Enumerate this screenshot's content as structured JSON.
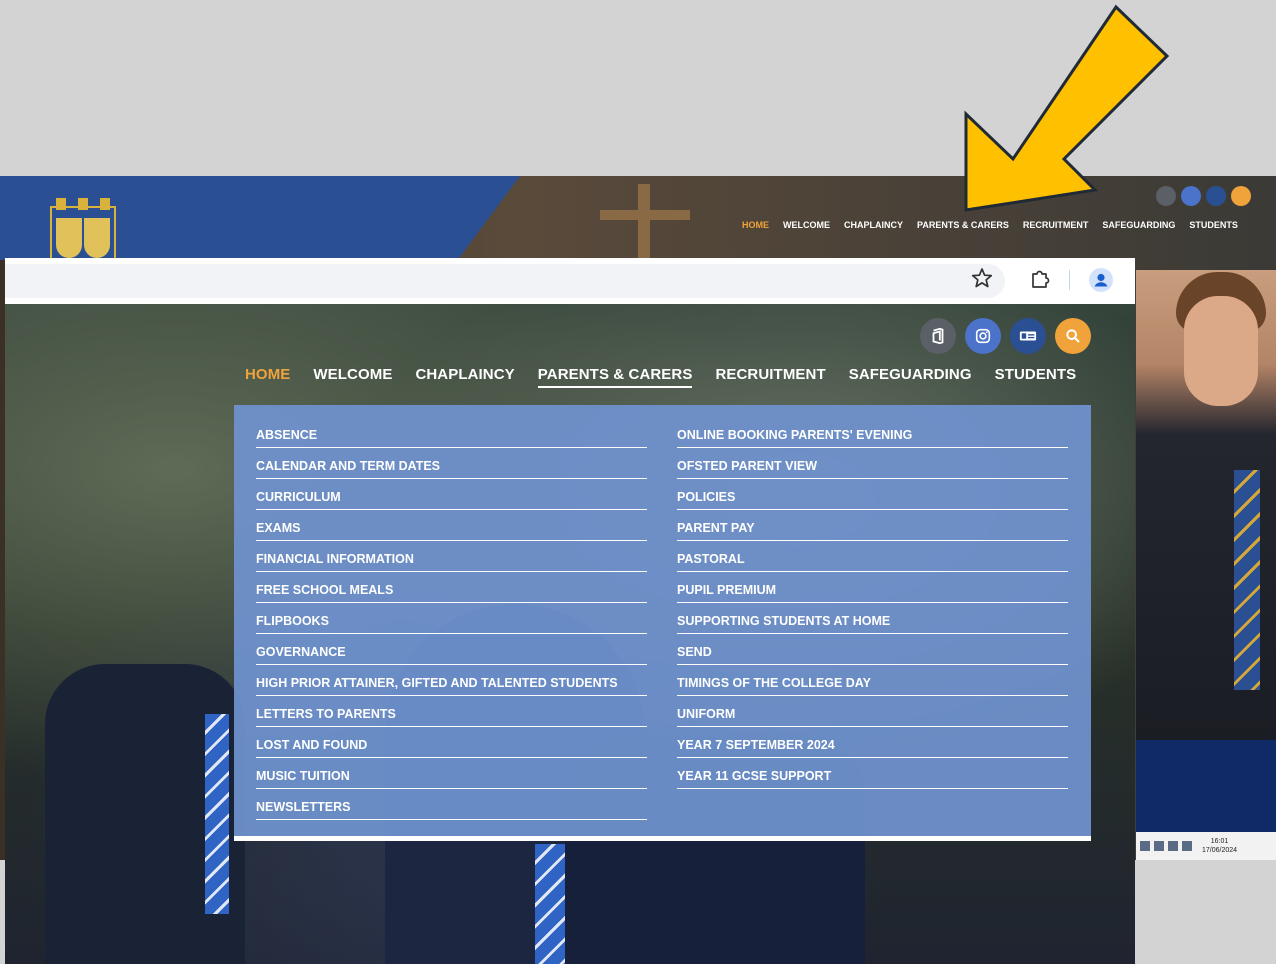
{
  "background_site": {
    "nav": [
      "HOME",
      "WELCOME",
      "CHAPLAINCY",
      "PARENTS & CARERS",
      "RECRUITMENT",
      "SAFEGUARDING",
      "STUDENTS"
    ],
    "clock_time": "16:01",
    "clock_date": "17/06/2024"
  },
  "icons": {
    "office": "office-icon",
    "instagram": "instagram-icon",
    "id_card": "id-card-icon",
    "search": "search-icon"
  },
  "colors": {
    "accent_orange": "#f0a33a",
    "brand_blue": "#2a4f93",
    "menu_blue": "#6e92cd",
    "arrow_yellow": "#ffc000"
  },
  "main_nav": {
    "items": [
      {
        "label": "HOME",
        "state": "active"
      },
      {
        "label": "WELCOME"
      },
      {
        "label": "CHAPLAINCY"
      },
      {
        "label": "PARENTS & CARERS",
        "state": "open"
      },
      {
        "label": "RECRUITMENT"
      },
      {
        "label": "SAFEGUARDING"
      },
      {
        "label": "STUDENTS"
      }
    ]
  },
  "parents_menu": {
    "left": [
      "ABSENCE",
      "CALENDAR AND TERM DATES",
      "CURRICULUM",
      "EXAMS",
      "FINANCIAL INFORMATION",
      "FREE SCHOOL MEALS",
      "FLIPBOOKS",
      "GOVERNANCE",
      "HIGH PRIOR ATTAINER, GIFTED AND TALENTED STUDENTS",
      "LETTERS TO PARENTS",
      "LOST AND FOUND",
      "MUSIC TUITION",
      "NEWSLETTERS"
    ],
    "right": [
      "ONLINE BOOKING PARENTS' EVENING",
      "OFSTED PARENT VIEW",
      "POLICIES",
      "PARENT PAY",
      "PASTORAL",
      "PUPIL PREMIUM",
      "SUPPORTING STUDENTS AT HOME",
      "SEND",
      "TIMINGS OF THE COLLEGE DAY",
      "UNIFORM",
      "YEAR 7 SEPTEMBER 2024",
      "YEAR 11 GCSE SUPPORT"
    ]
  }
}
